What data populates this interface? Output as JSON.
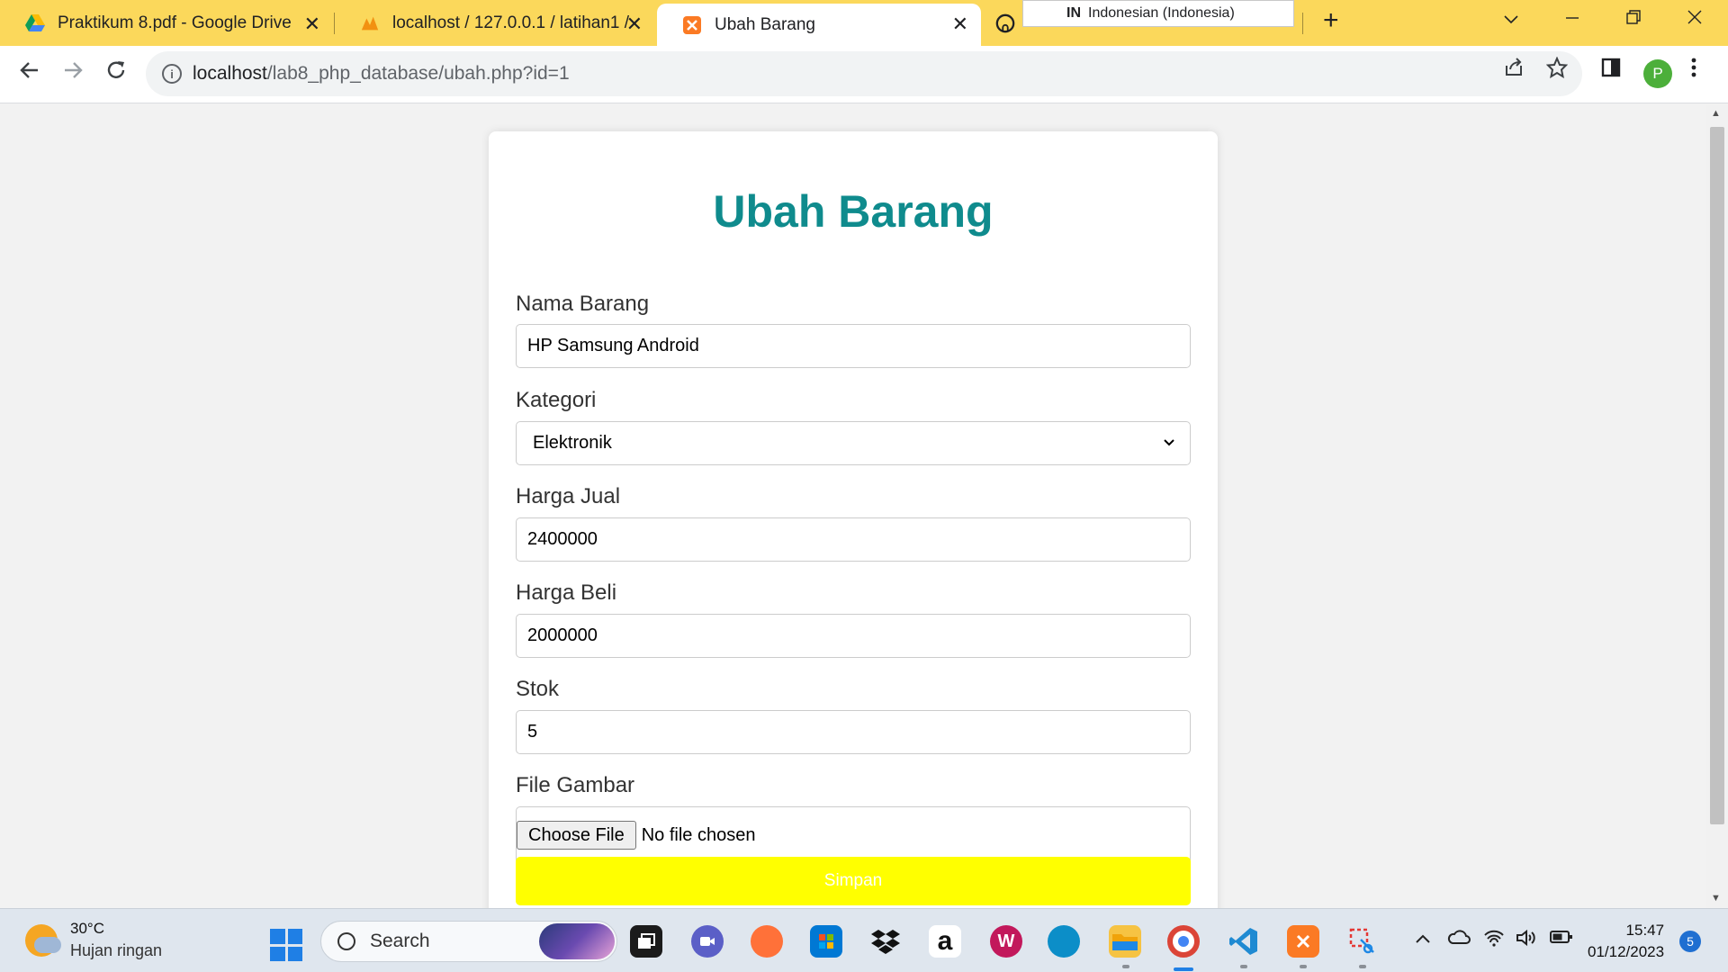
{
  "browser": {
    "tabs": [
      {
        "title": "Praktikum 8.pdf - Google Drive",
        "icon": "google-drive-icon",
        "close": "✕"
      },
      {
        "title": "localhost / 127.0.0.1 / latihan1 /",
        "icon": "phpmyadmin-icon",
        "close": "✕"
      },
      {
        "title": "Ubah Barang",
        "icon": "xampp-icon",
        "close": "✕",
        "active": true
      },
      {
        "title": "",
        "icon": "github-icon"
      }
    ],
    "language_popup": {
      "code": "IN",
      "label": "Indonesian (Indonesia)"
    },
    "new_tab": "+",
    "url_host": "localhost",
    "url_path": "/lab8_php_database/ubah.php?id=1",
    "profile_initial": "P"
  },
  "page": {
    "title": "Ubah Barang",
    "fields": {
      "nama": {
        "label": "Nama Barang",
        "value": "HP Samsung Android"
      },
      "kategori": {
        "label": "Kategori",
        "value": "Elektronik"
      },
      "harga_jual": {
        "label": "Harga Jual",
        "value": "2400000"
      },
      "harga_beli": {
        "label": "Harga Beli",
        "value": "2000000"
      },
      "stok": {
        "label": "Stok",
        "value": "5"
      },
      "gambar": {
        "label": "File Gambar",
        "button": "Choose File",
        "status": "No file chosen"
      }
    },
    "submit_label": "Simpan",
    "colors": {
      "title": "#0f8b8d",
      "submit_bg": "#ffff00",
      "tabstrip": "#fbd85b"
    }
  },
  "taskbar": {
    "weather_temp": "30°C",
    "weather_desc": "Hujan ringan",
    "search_placeholder": "Search",
    "time": "15:47",
    "date": "01/12/2023",
    "notification_count": "5"
  }
}
